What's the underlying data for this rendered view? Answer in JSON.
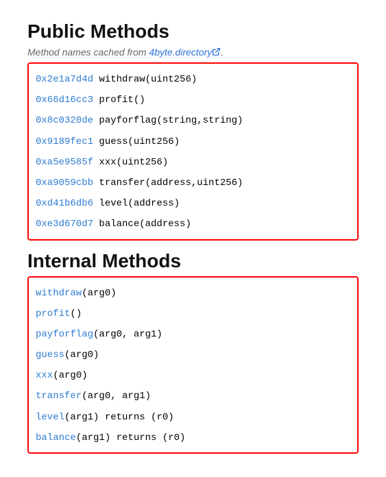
{
  "section1": {
    "title": "Public Methods",
    "caption_prefix": "Method names cached from ",
    "caption_link_text": "4byte.directory",
    "caption_suffix": ".",
    "methods": [
      {
        "selector": "0x2e1a7d4d",
        "sig": " withdraw(uint256)"
      },
      {
        "selector": "0x66d16cc3",
        "sig": " profit()"
      },
      {
        "selector": "0x8c0320de",
        "sig": " payforflag(string,string)"
      },
      {
        "selector": "0x9189fec1",
        "sig": " guess(uint256)"
      },
      {
        "selector": "0xa5e9585f",
        "sig": " xxx(uint256)"
      },
      {
        "selector": "0xa9059cbb",
        "sig": " transfer(address,uint256)"
      },
      {
        "selector": "0xd41b6db6",
        "sig": " level(address)"
      },
      {
        "selector": "0xe3d670d7",
        "sig": " balance(address)"
      }
    ]
  },
  "section2": {
    "title": "Internal Methods",
    "methods": [
      {
        "name": "withdraw",
        "rest": "(arg0)"
      },
      {
        "name": "profit",
        "rest": "()"
      },
      {
        "name": "payforflag",
        "rest": "(arg0, arg1)"
      },
      {
        "name": "guess",
        "rest": "(arg0)"
      },
      {
        "name": "xxx",
        "rest": "(arg0)"
      },
      {
        "name": "transfer",
        "rest": "(arg0, arg1)"
      },
      {
        "name": "level",
        "rest": "(arg1) returns (r0)"
      },
      {
        "name": "balance",
        "rest": "(arg1) returns (r0)"
      }
    ]
  }
}
